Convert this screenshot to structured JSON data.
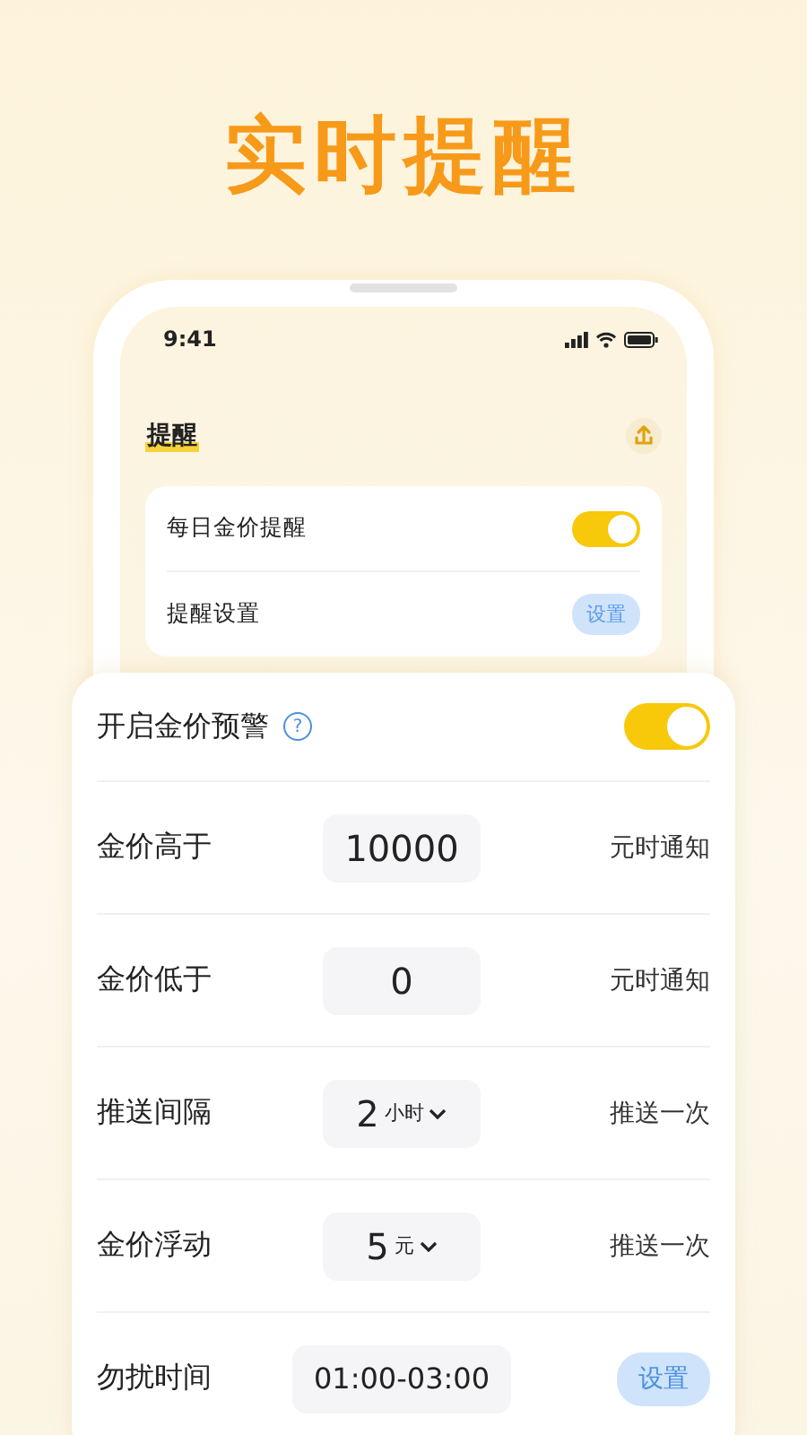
{
  "headline": "实时提醒",
  "phone": {
    "status_time": "9:41",
    "title": "提醒",
    "settings": [
      {
        "kind": "toggle",
        "label": "每日金价提醒",
        "on": true
      },
      {
        "kind": "button",
        "label": "提醒设置",
        "button": "设置"
      }
    ]
  },
  "alert_panel": {
    "title": "开启金价预警",
    "help_icon": "?",
    "on": true,
    "rows": [
      {
        "kind": "input",
        "label": "金价高于",
        "value": "10000",
        "suffix": "元时通知"
      },
      {
        "kind": "input",
        "label": "金价低于",
        "value": "0",
        "suffix": "元时通知"
      },
      {
        "kind": "select",
        "label": "推送间隔",
        "value": "2",
        "unit": "小时",
        "suffix": "推送一次"
      },
      {
        "kind": "select",
        "label": "金价浮动",
        "value": "5",
        "unit": "元",
        "suffix": "推送一次"
      },
      {
        "kind": "time",
        "label": "勿扰时间",
        "value": "01:00-03:00",
        "button": "设置"
      }
    ]
  }
}
